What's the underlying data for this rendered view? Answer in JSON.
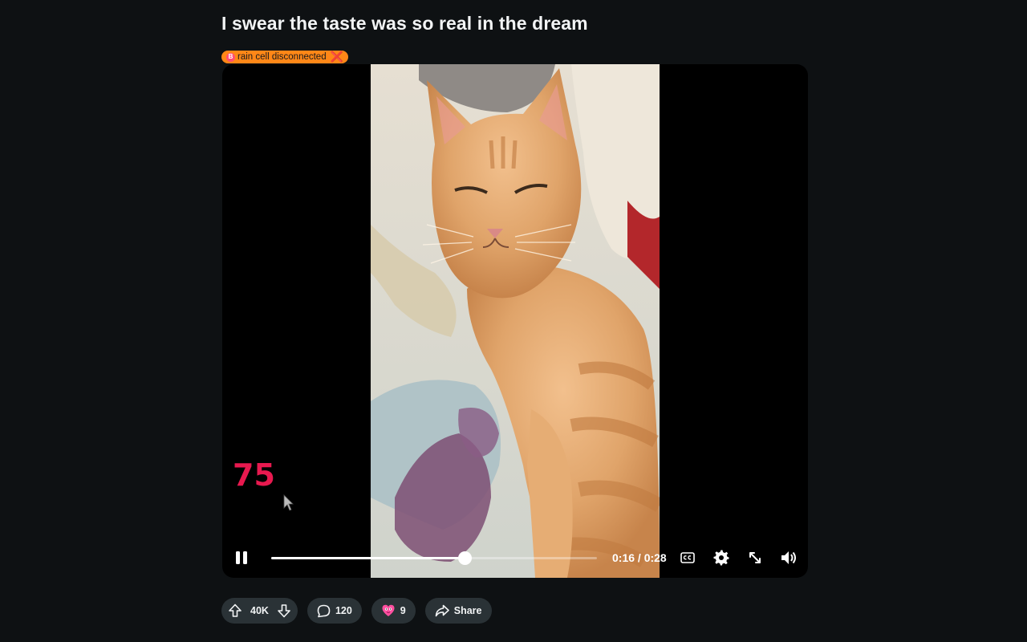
{
  "post": {
    "title": "I swear the taste was so real in the dream",
    "flair": {
      "emoji_letter": "B",
      "text": "rain cell disconnected",
      "close_glyph": "❌"
    }
  },
  "video": {
    "overlay_number": "75",
    "time": "0:16 / 0:28",
    "progress": 0.594,
    "buttons": {
      "pause": "pause-icon",
      "captions": "cc-icon",
      "settings": "gear-icon",
      "fullscreen": "expand-icon",
      "volume": "volume-icon"
    }
  },
  "actions": {
    "votes": "40K",
    "comments": "120",
    "awards": "9",
    "share": "Share"
  },
  "colors": {
    "background": "#0e1113",
    "pill": "#2a3236",
    "flair": "#ff8717",
    "overlay_number": "#e8194f"
  }
}
